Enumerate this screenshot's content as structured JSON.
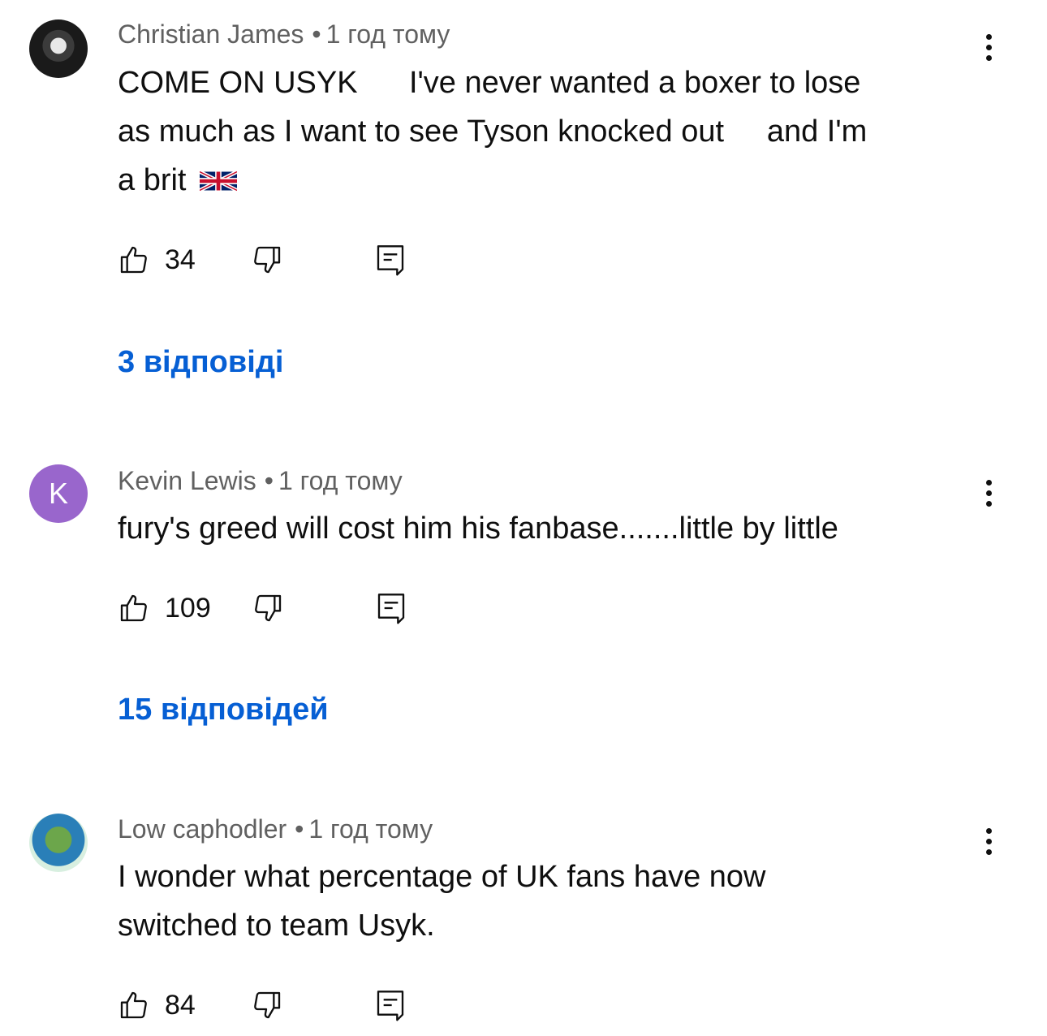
{
  "comments": [
    {
      "author": "Christian James",
      "time": "1 год тому",
      "text_lines": [
        "COME ON USYK      I've never wanted a boxer to lose",
        "as much as I want to see Tyson knocked out     and I'm",
        "a brit"
      ],
      "emoji": "gb-flag",
      "likes": "34",
      "replies": "3 відповіді",
      "avatar_icon": "user-photo-icon"
    },
    {
      "author": "Kevin Lewis",
      "time": "1 год тому",
      "text_lines": [
        "fury's greed will cost him his fanbase.......little by little"
      ],
      "likes": "109",
      "replies": "15 відповідей",
      "avatar_letter": "K",
      "avatar_color": "#9966cc"
    },
    {
      "author": "Low caphodler",
      "time": "1 год тому",
      "text_lines": [
        "I wonder what percentage of UK fans have now",
        "switched to team Usyk."
      ],
      "likes": "84",
      "avatar_icon": "meme-avatar-icon"
    }
  ],
  "colors": {
    "link": "#065fd4",
    "meta": "#606060",
    "text": "#0f0f0f"
  }
}
